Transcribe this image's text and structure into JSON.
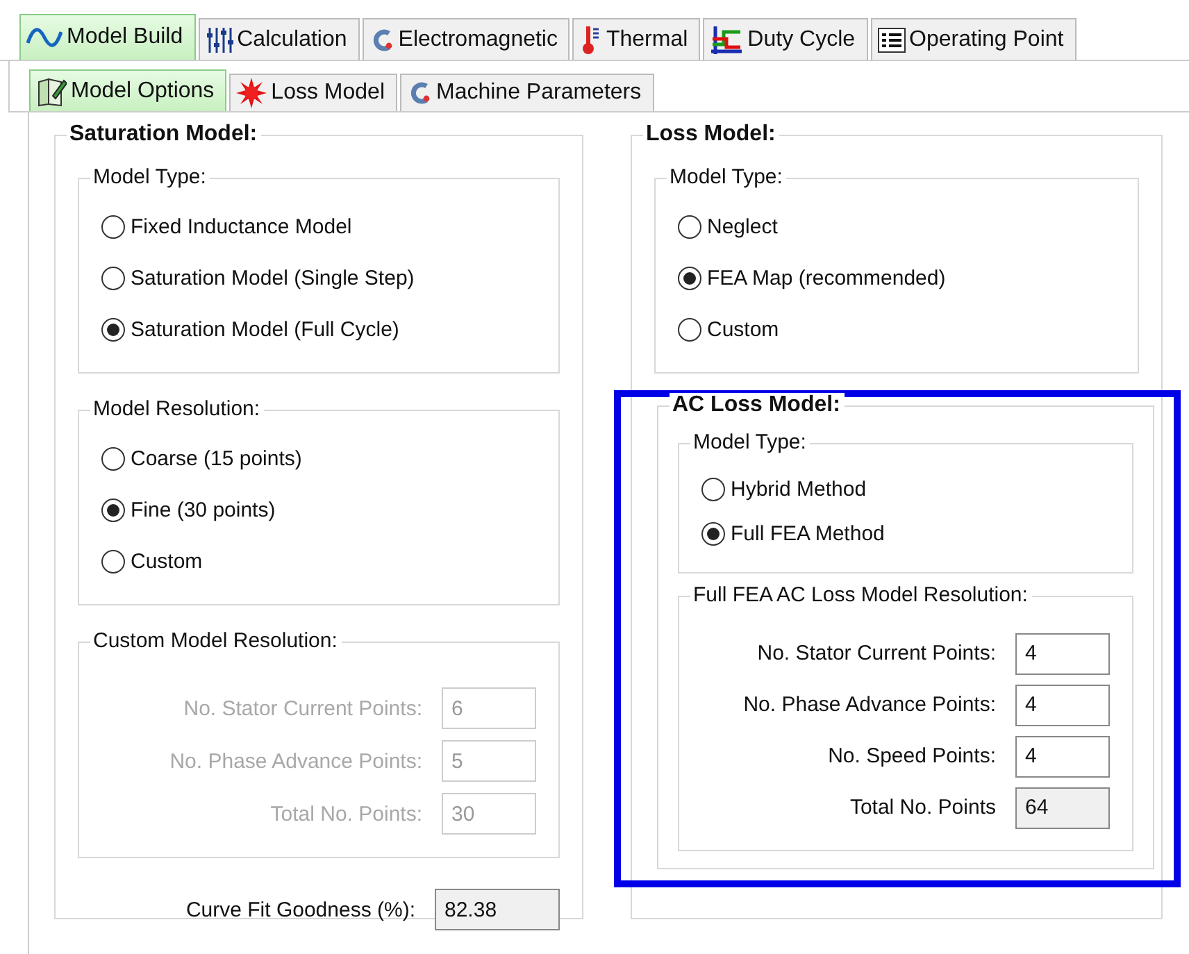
{
  "tabs": [
    {
      "label": "Model Build",
      "selected": true
    },
    {
      "label": "Calculation",
      "selected": false
    },
    {
      "label": "Electromagnetic",
      "selected": false
    },
    {
      "label": "Thermal",
      "selected": false
    },
    {
      "label": "Duty Cycle",
      "selected": false
    },
    {
      "label": "Operating Point",
      "selected": false
    }
  ],
  "subtabs": [
    {
      "label": "Model Options",
      "selected": true
    },
    {
      "label": "Loss Model",
      "selected": false
    },
    {
      "label": "Machine Parameters",
      "selected": false
    }
  ],
  "saturation_model": {
    "title": "Saturation Model:",
    "groups": [
      {
        "title": "Model Type:",
        "kind": "radio",
        "disabled": false,
        "options": [
          {
            "label": "Fixed Inductance Model",
            "selected": false
          },
          {
            "label": "Saturation Model (Single Step)",
            "selected": false
          },
          {
            "label": "Saturation Model (Full Cycle)",
            "selected": true
          }
        ]
      },
      {
        "title": "Model Resolution:",
        "kind": "radio",
        "disabled": false,
        "options": [
          {
            "label": "Coarse (15 points)",
            "selected": false
          },
          {
            "label": "Fine (30 points)",
            "selected": true
          },
          {
            "label": "Custom",
            "selected": false
          }
        ]
      },
      {
        "title": "Custom Model Resolution:",
        "kind": "fields",
        "disabled": true,
        "fields": [
          {
            "label": "No. Stator Current Points:",
            "value": "6",
            "readonly": false
          },
          {
            "label": "No. Phase Advance Points:",
            "value": "5",
            "readonly": false
          },
          {
            "label": "Total No. Points:",
            "value": "30",
            "readonly": false
          }
        ]
      }
    ],
    "curve_fit": {
      "label": "Curve Fit Goodness (%):",
      "value": "82.38",
      "readonly": true
    }
  },
  "loss_model": {
    "title": "Loss Model:",
    "groups": [
      {
        "title": "Model Type:",
        "kind": "radio",
        "disabled": false,
        "options": [
          {
            "label": "Neglect",
            "selected": false
          },
          {
            "label": "FEA Map (recommended)",
            "selected": true
          },
          {
            "label": "Custom",
            "selected": false
          }
        ]
      }
    ],
    "ac_loss_model": {
      "title": "AC Loss Model:",
      "highlighted": true,
      "groups": [
        {
          "title": "Model Type:",
          "kind": "radio",
          "disabled": false,
          "options": [
            {
              "label": "Hybrid Method",
              "selected": false
            },
            {
              "label": "Full FEA Method",
              "selected": true
            }
          ]
        },
        {
          "title": "Full FEA AC Loss Model Resolution:",
          "kind": "fields",
          "disabled": false,
          "fields": [
            {
              "label": "No. Stator Current Points:",
              "value": "4",
              "readonly": false
            },
            {
              "label": "No. Phase Advance Points:",
              "value": "4",
              "readonly": false
            },
            {
              "label": "No. Speed Points:",
              "value": "4",
              "readonly": false
            },
            {
              "label": "Total No. Points",
              "value": "64",
              "readonly": true
            }
          ]
        }
      ]
    }
  }
}
